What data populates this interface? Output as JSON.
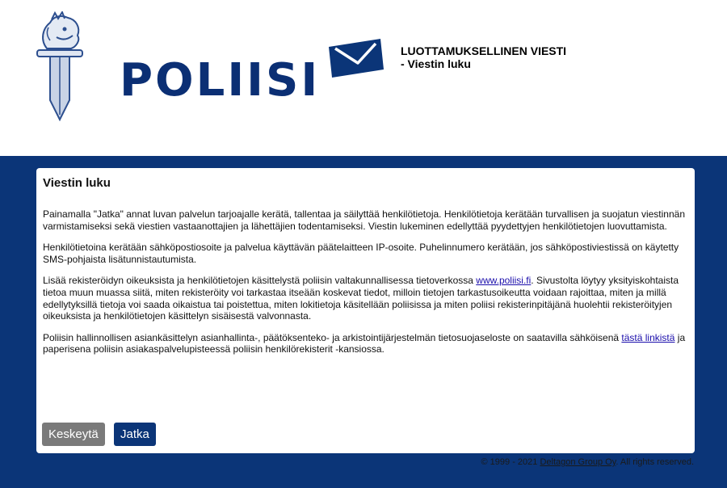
{
  "header": {
    "logo_text": "POLIISI",
    "title_line1": "LUOTTAMUKSELLINEN VIESTI",
    "title_line2": "- Viestin luku"
  },
  "card": {
    "title": "Viestin luku",
    "para1": "Painamalla \"Jatka\" annat luvan palvelun tarjoajalle kerätä, tallentaa ja säilyttää henkilötietoja. Henkilötietoja kerätään turvallisen ja suojatun viestinnän varmistamiseksi sekä viestien vastaanottajien ja lähettäjien todentamiseksi. Viestin lukeminen edellyttää pyydettyjen henkilötietojen luovuttamista.",
    "para2": "Henkilötietoina kerätään sähköpostiosoite ja palvelua käyttävän päätelaitteen IP-osoite. Puhelinnumero kerätään, jos sähköpostiviestissä on käytetty SMS-pohjaista lisätunnistautumista.",
    "para3_before": "Lisää rekisteröidyn oikeuksista ja henkilötietojen käsittelystä poliisin valtakunnallisessa tietoverkossa ",
    "para3_link": "www.poliisi.fi",
    "para3_after": ". Sivustolta löytyy yksityiskohtaista tietoa muun muassa siitä, miten rekisteröity voi tarkastaa itseään koskevat tiedot, milloin tietojen tarkastusoikeutta voidaan rajoittaa, miten ja millä edellytyksillä tietoja voi saada oikaistua tai poistettua, miten lokitietoja käsitellään poliisissa ja miten poliisi rekisterinpitäjänä huolehtii rekisteröityjen oikeuksista ja henkilötietojen käsittelyn sisäisestä valvonnasta.",
    "para4_before": "Poliisin hallinnollisen asiankäsittelyn asianhallinta-, päätöksenteko- ja arkistointijärjestelmän tietosuojaseloste on saatavilla sähköisenä ",
    "para4_link": "tästä linkistä",
    "para4_after": " ja paperisena poliisin asiakaspalvelupisteessä poliisin henkilörekisterit -kansiossa.",
    "cancel_label": "Keskeytä",
    "continue_label": "Jatka"
  },
  "footer": {
    "copyright": "© 1999 - 2021 ",
    "company_link": "Deltagon Group Oy",
    "rights": ". All rights reserved."
  },
  "colors": {
    "brand_blue": "#0b3578",
    "cancel_gray": "#7a7a7a"
  }
}
